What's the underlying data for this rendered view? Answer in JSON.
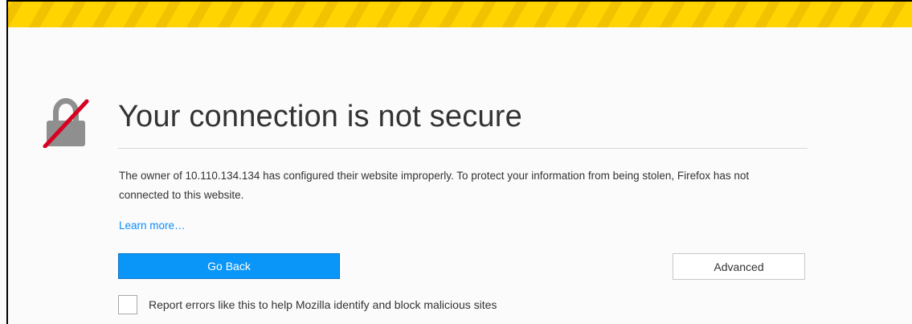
{
  "page": {
    "title": "Your connection is not secure",
    "description": "The owner of 10.110.134.134 has configured their website improperly. To protect your information from being stolen, Firefox has not connected to this website.",
    "learn_more": "Learn more…",
    "go_back_label": "Go Back",
    "advanced_label": "Advanced",
    "report_label": "Report errors like this to help Mozilla identify and block malicious sites"
  },
  "icons": {
    "main": "broken-lock-icon"
  },
  "colors": {
    "warning_stripe": "#ffd400",
    "primary_button": "#0996f8",
    "link": "#0a8dff",
    "lock_gray": "#8f8f8f",
    "slash_red": "#d70022"
  }
}
